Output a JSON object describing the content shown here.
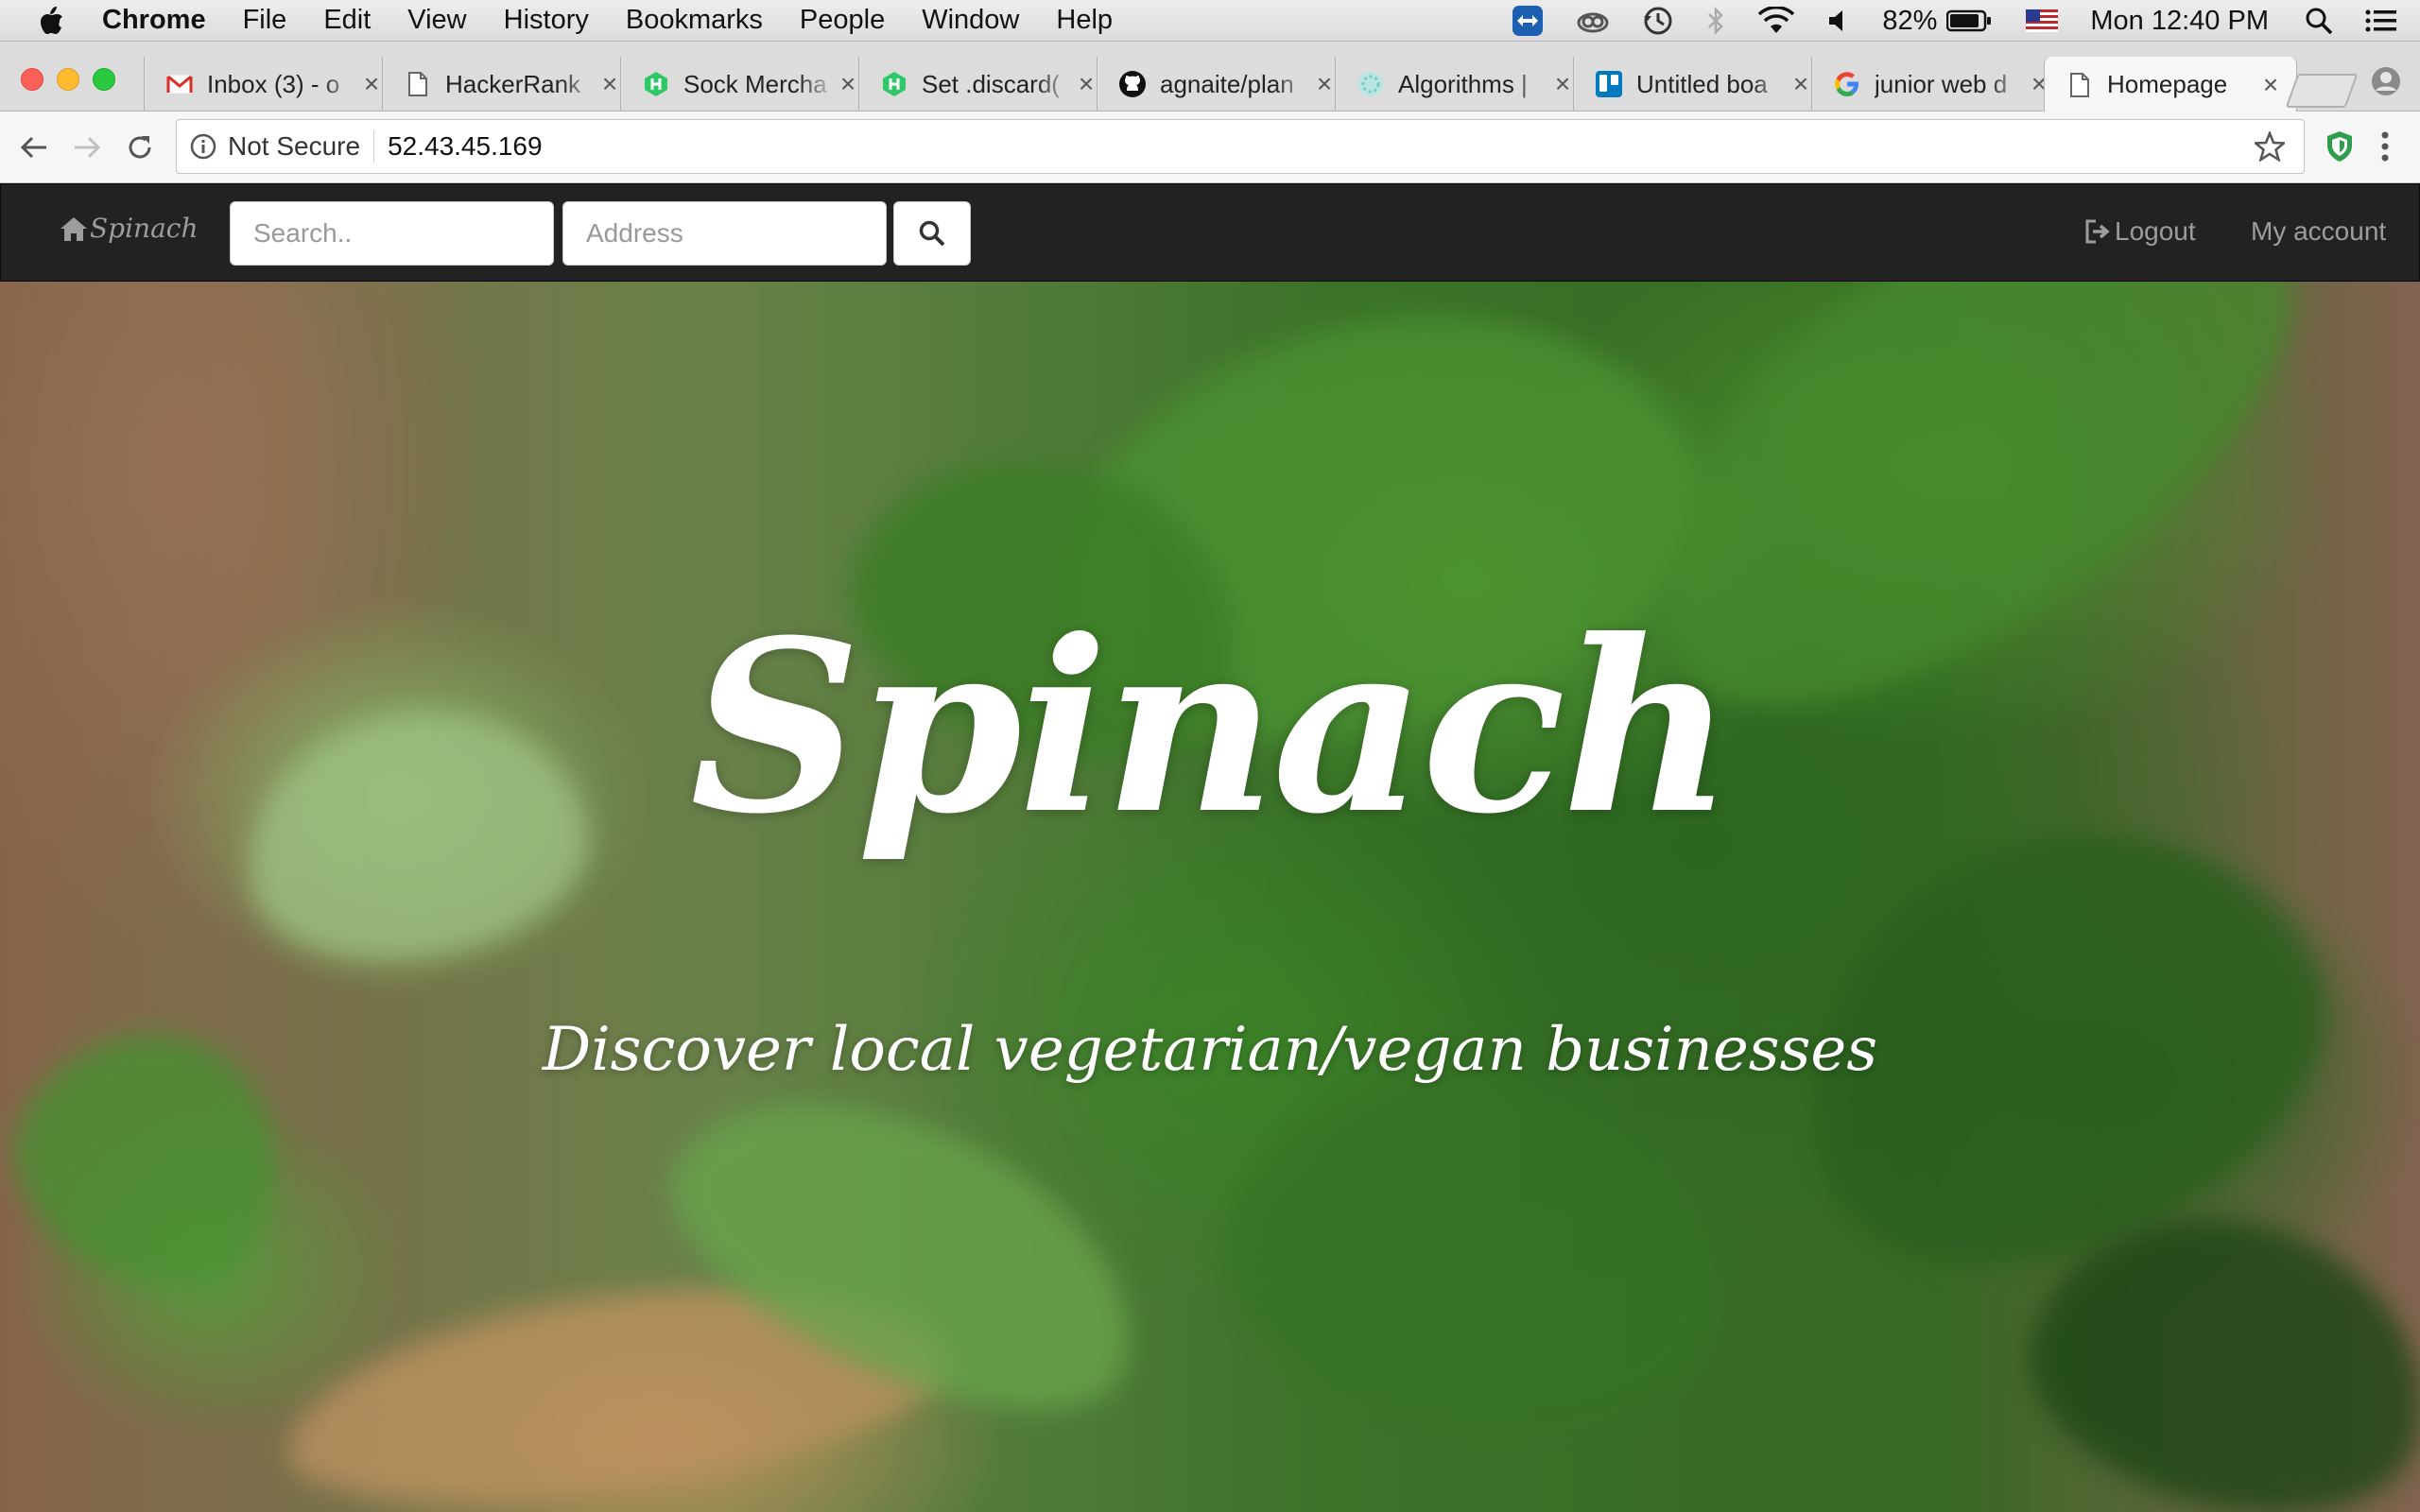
{
  "menubar": {
    "items": [
      "Chrome",
      "File",
      "Edit",
      "View",
      "History",
      "Bookmarks",
      "People",
      "Window",
      "Help"
    ],
    "battery_percent": "82%",
    "clock": "Mon 12:40 PM"
  },
  "tabs": [
    {
      "title": "Inbox (3) - o",
      "icon": "gmail-icon"
    },
    {
      "title": "HackerRank",
      "icon": "page-icon"
    },
    {
      "title": "Sock Mercha",
      "icon": "hackerrank-icon"
    },
    {
      "title": "Set .discard(",
      "icon": "hackerrank-icon"
    },
    {
      "title": "agnaite/plan",
      "icon": "github-icon"
    },
    {
      "title": "Algorithms |",
      "icon": "algorithms-icon"
    },
    {
      "title": "Untitled boa",
      "icon": "trello-icon"
    },
    {
      "title": "junior web d",
      "icon": "google-icon"
    },
    {
      "title": "Homepage",
      "icon": "page-icon"
    }
  ],
  "addressbar": {
    "security_label": "Not Secure",
    "url": "52.43.45.169"
  },
  "site": {
    "brand": "Spinach",
    "search_placeholder": "Search..",
    "address_placeholder": "Address",
    "logout_label": "Logout",
    "account_label": "My account",
    "hero_title": "Spinach",
    "hero_subtitle": "Discover local vegetarian/vegan businesses"
  },
  "colors": {
    "navbar_bg": "#222222",
    "navbar_text": "#9d9d9d",
    "hero_text": "#ffffff"
  }
}
